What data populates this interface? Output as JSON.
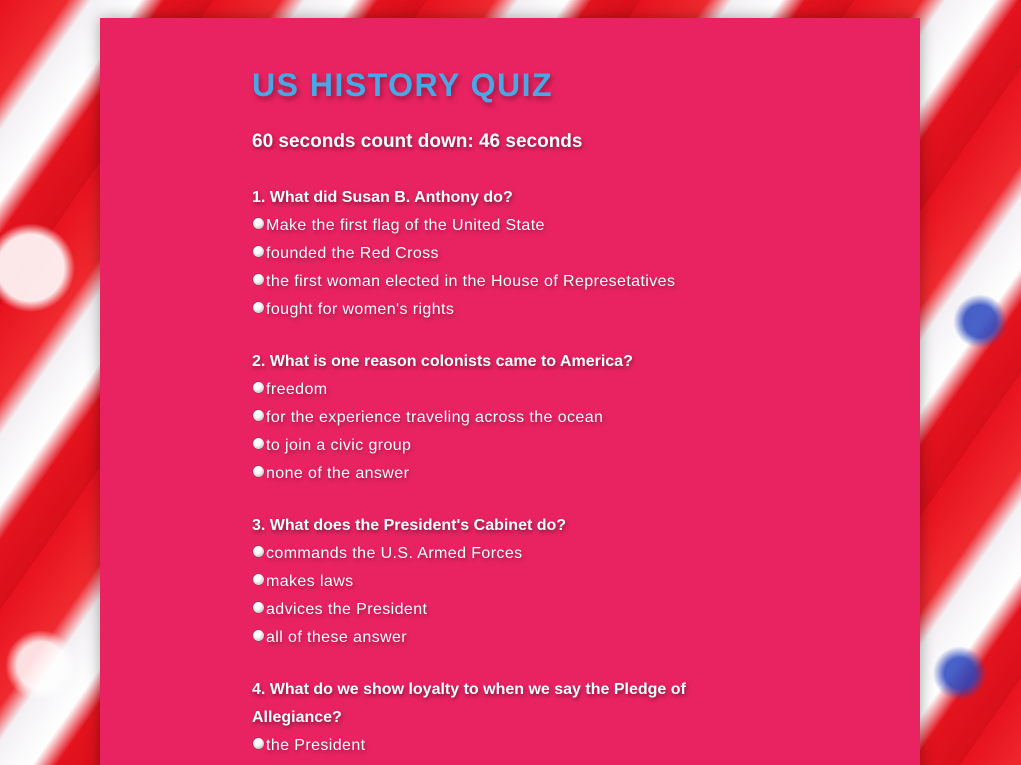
{
  "quiz": {
    "title": "US HISTORY QUIZ",
    "countdown": "60 seconds count down: 46 seconds"
  },
  "questions": [
    {
      "text": "1. What did Susan B. Anthony do?",
      "options": [
        "Make the first flag of the United State",
        "founded the Red Cross",
        "the first woman elected in the House of Represetatives",
        "fought for women's rights"
      ]
    },
    {
      "text": "2. What is one reason colonists came to America?",
      "options": [
        "freedom",
        "for the experience traveling across the ocean",
        "to join a civic group",
        "none of the answer"
      ]
    },
    {
      "text": "3. What does the President's Cabinet do?",
      "options": [
        "commands the U.S. Armed Forces",
        "makes laws",
        "advices the President",
        "all of these answer"
      ]
    },
    {
      "text": "4. What do we show loyalty to when we say the Pledge of Allegiance?",
      "options": [
        "the President"
      ]
    }
  ],
  "colors": {
    "panel": "#e92361",
    "title": "#4aa7e6",
    "text": "#ffffff"
  }
}
